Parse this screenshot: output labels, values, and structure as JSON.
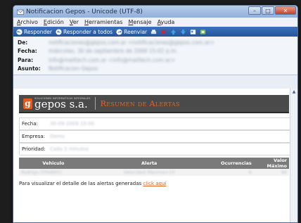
{
  "window": {
    "title": "Notificacion Gepos - Unicode (UTF-8)",
    "controls": [
      "–",
      "□",
      "✕"
    ]
  },
  "menu": [
    "Archivo",
    "Edición",
    "Ver",
    "Herramientas",
    "Mensaje",
    "Ayuda"
  ],
  "toolbar": {
    "reply": "Responder",
    "reply_all": "Responder a todos",
    "forward": "Reenviar"
  },
  "headers": [
    {
      "label": "De:",
      "value": "notificaciones@gepos.com.ar <notificaciones@gepos.com.ar>"
    },
    {
      "label": "Fecha:",
      "value": "miércoles, 30 de septiembre de 2009 15:02 p.m."
    },
    {
      "label": "Para:",
      "value": "info@mailtech.com.ar <info@mailtech.com.ar>"
    },
    {
      "label": "Asunto:",
      "value": "Notificacion Gepos"
    }
  ],
  "logo": {
    "badge": "g",
    "tagline": "SOLUCIONES INFORMATICAS INTEGRALES",
    "name": "gepos s.a.",
    "heading": "Resumen de Alertas"
  },
  "fields": [
    {
      "label": "Fecha:",
      "value": "30-09-2009 15:00"
    },
    {
      "label": "Empresa:",
      "value": "Demo"
    },
    {
      "label": "Prioridad:",
      "value": "Cada 5 minutos"
    }
  ],
  "table": {
    "headers": [
      "Vehiculo",
      "Alerta",
      "Ocurrencias",
      "Valor Máximo"
    ],
    "rows": [
      [
        "Rodrigo (TPH865)",
        "Velocidad Máxima>10",
        "6",
        "90"
      ]
    ]
  },
  "footer": {
    "text": "Para visualizar el detalle de las alertas generadas ",
    "link": "click aquí"
  }
}
